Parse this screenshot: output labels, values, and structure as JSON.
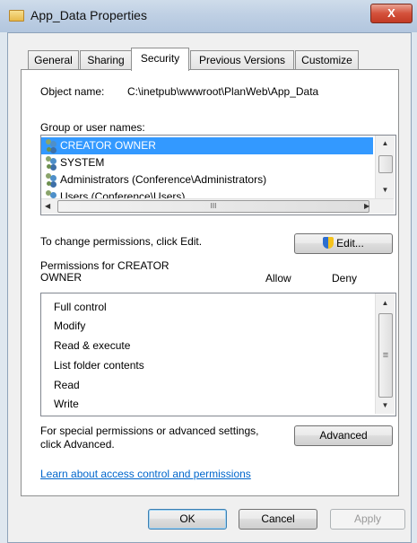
{
  "window": {
    "title": "App_Data Properties",
    "close_label": "X"
  },
  "tabs": [
    {
      "label": "General"
    },
    {
      "label": "Sharing"
    },
    {
      "label": "Security",
      "active": true
    },
    {
      "label": "Previous Versions"
    },
    {
      "label": "Customize"
    }
  ],
  "object": {
    "label": "Object name:",
    "value": "C:\\inetpub\\wwwroot\\PlanWeb\\App_Data"
  },
  "groups": {
    "label": "Group or user names:",
    "items": [
      {
        "label": "CREATOR OWNER",
        "selected": true
      },
      {
        "label": "SYSTEM"
      },
      {
        "label": "Administrators (Conference\\Administrators)"
      },
      {
        "label": "Users (Conference\\Users)"
      }
    ],
    "hscroll_grip": "III"
  },
  "change": {
    "text": "To change permissions, click Edit.",
    "edit_label": "Edit..."
  },
  "permissions": {
    "label": "Permissions for CREATOR OWNER",
    "allow_header": "Allow",
    "deny_header": "Deny",
    "items": [
      {
        "label": "Full control"
      },
      {
        "label": "Modify"
      },
      {
        "label": "Read & execute"
      },
      {
        "label": "List folder contents"
      },
      {
        "label": "Read"
      },
      {
        "label": "Write"
      }
    ]
  },
  "special": {
    "text": "For special permissions or advanced settings, click Advanced.",
    "advanced_label": "Advanced"
  },
  "link": {
    "text": "Learn about access control and permissions"
  },
  "footer": {
    "ok_label": "OK",
    "cancel_label": "Cancel",
    "apply_label": "Apply"
  },
  "scroll_glyphs": {
    "up": "▲",
    "down": "▼",
    "left": "◀",
    "right": "▶",
    "grip": "≡"
  }
}
